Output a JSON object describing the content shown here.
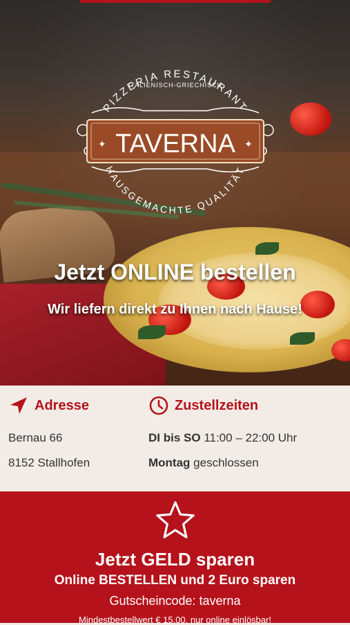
{
  "brand": {
    "arc_top": "PIZZERIA RESTAURANT",
    "tagline": "ITALIENISCH-GRIECHISCH",
    "name": "TAVERNA",
    "arc_bottom": "HAUSGEMACHTE QUALITÄT"
  },
  "hero": {
    "title": "Jetzt ONLINE bestellen",
    "subtitle": "Wir liefern direkt zu Ihnen nach Hause!"
  },
  "address": {
    "heading": "Adresse",
    "street": "Bernau 66",
    "city": "8152 Stallhofen",
    "icon": "location-arrow-icon"
  },
  "delivery": {
    "heading": "Zustellzeiten",
    "icon": "clock-icon",
    "rows": [
      {
        "days": "DI bis SO",
        "hours": "11:00 – 22:00 Uhr"
      },
      {
        "days": "Montag",
        "hours": "geschlossen"
      }
    ]
  },
  "promo": {
    "icon": "star-icon",
    "title": "Jetzt GELD sparen",
    "subtitle": "Online BESTELLEN und 2 Euro sparen",
    "code_line": "Gutscheincode: taverna",
    "note": "Mindestbestellwert € 15,00, nur online einlösbar!"
  },
  "colors": {
    "accent": "#b5121b",
    "info_bg": "#f3ece6"
  }
}
